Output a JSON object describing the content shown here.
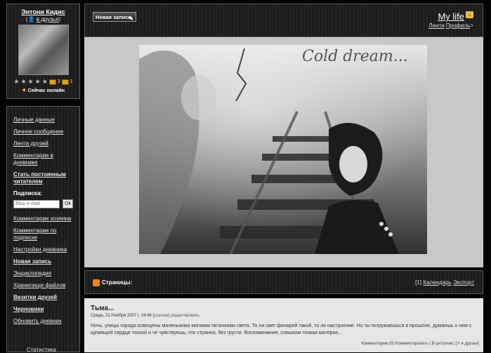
{
  "profile": {
    "username": "Энтони Кидис",
    "friends_prefix": "(",
    "friends_link": "в друзья",
    "friends_suffix": ")",
    "rating_stars": [
      "★",
      "★",
      "★",
      "★",
      "★"
    ],
    "counter_a": "3",
    "counter_b": "1",
    "online_status": "Сейчас онлайн"
  },
  "menu": {
    "items_top": [
      "Личные данные",
      "Личное сообщение",
      "Лента друзей",
      "Комментарии в дневнике",
      "Стать постоянным читателем"
    ],
    "subscribe_label": "Подписка:",
    "email_placeholder": "Ваш e-mail",
    "ok_label": "Ok",
    "items_bottom": [
      "Комментарии хозяина",
      "Комментарии по подписке",
      "Настройки дневника",
      "Новая запись",
      "Энциклопедия",
      "Хранилище файлов",
      "Визитки друзей",
      "Черновики",
      "Обновить дневник"
    ],
    "bottom_partial": "Статистика"
  },
  "header": {
    "new_post_label": "Новая запись",
    "blog_title": "My life",
    "link_feed": "Лента",
    "link_profile": "Профиль",
    "link_arrow": ">"
  },
  "banner": {
    "title": "Cold dream..."
  },
  "pages_bar": {
    "label": "Страницы:",
    "counter": "[1]",
    "calendar": "Календарь",
    "export": "Экспорт"
  },
  "post": {
    "title": "Тьма...",
    "meta_date": "Среда, 21 Ноября 2007 г. 19:48",
    "meta_link": "ссылка",
    "meta_edit": "редактировать",
    "text": "Ночь, улицы города освещены маленькими мягкими пятачками света. То ли свет фонарей такой, то ли настроение. Но ты погружаешься в прошлое, думаешь о нем с щемящей сердце тоской и че чувствуешь, что странно, без грусти. Воспоминания, слишком тонкая материя…",
    "comments": "Комментарии (0)",
    "comment_link": "Комментировать",
    "quote_link": "В цитатник",
    "friends_link": "в друзья"
  }
}
